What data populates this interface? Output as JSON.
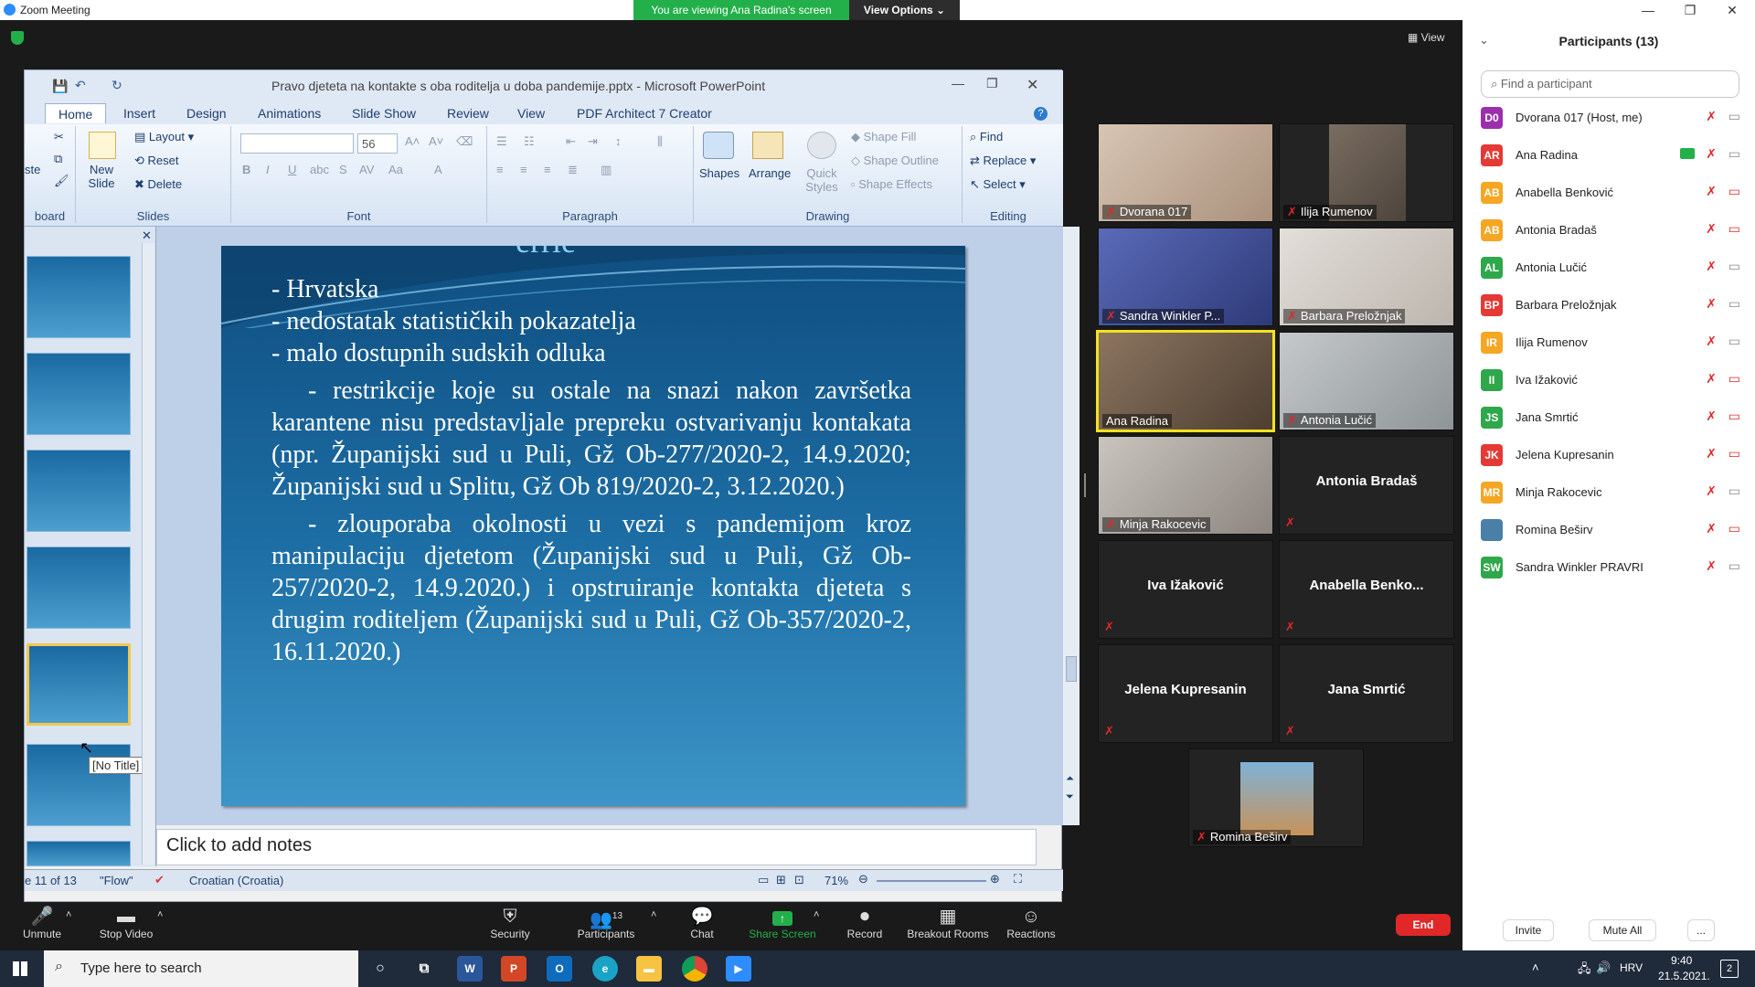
{
  "window": {
    "title": "Zoom Meeting",
    "banner": "You are viewing Ana Radina's screen",
    "view_options": "View Options",
    "view": "View"
  },
  "ppt": {
    "title": "Pravo djeteta na kontakte s oba roditelja u doba pandemije.pptx - Microsoft PowerPoint",
    "tabs": [
      "Home",
      "Insert",
      "Design",
      "Animations",
      "Slide Show",
      "Review",
      "View",
      "PDF Architect 7 Creator"
    ],
    "ribbon": {
      "clipboard_label": "board",
      "paste": "ste",
      "new_slide": "New Slide",
      "layout": "Layout",
      "reset": "Reset",
      "delete": "Delete",
      "slides_label": "Slides",
      "font_size": "56",
      "font_label": "Font",
      "paragraph_label": "Paragraph",
      "shapes": "Shapes",
      "arrange": "Arrange",
      "quick_styles": "Quick Styles",
      "shape_fill": "Shape Fill",
      "shape_outline": "Shape Outline",
      "shape_effects": "Shape Effects",
      "drawing_label": "Drawing",
      "find": "Find",
      "replace": "Replace",
      "select": "Select",
      "editing_label": "Editing"
    },
    "slide": {
      "title_fragment": "errie",
      "lines": [
        "- Hrvatska",
        "- nedostatak statističkih pokazatelja",
        "- malo dostupnih sudskih odluka"
      ],
      "para1": "- restrikcije koje su ostale na snazi nakon završetka karantene nisu predstavljale prepreku ostvarivanju kontakata (npr. Županijski sud u Puli, Gž Ob-277/2020-2, 14.9.2020; Županijski sud u Splitu, Gž Ob 819/2020-2, 3.12.2020.)",
      "para2": "- zlouporaba okolnosti u vezi s pandemijom kroz manipulaciju djetetom (Županijski sud u Puli, Gž Ob-257/2020-2, 14.9.2020.) i opstruiranje kontakta djeteta s drugim roditeljem (Županijski sud u Puli, Gž Ob-357/2020-2, 16.11.2020.)"
    },
    "tooltip": "[No Title]",
    "notes": "Click to add notes",
    "status": {
      "slide": "e 11 of 13",
      "theme": "\"Flow\"",
      "language": "Croatian (Croatia)",
      "zoom": "71%"
    }
  },
  "videos": [
    {
      "name": "Dvorana 017",
      "bg": "#c9b8a8",
      "kind": "video"
    },
    {
      "name": "Ilija Rumenov",
      "bg": "#6e6358",
      "kind": "video"
    },
    {
      "name": "Sandra Winkler P...",
      "bg": "#4a5aa8",
      "kind": "video"
    },
    {
      "name": "Barbara Preložnjak",
      "bg": "#d8d4cf",
      "kind": "video"
    },
    {
      "name": "Ana Radina",
      "bg": "#7d6a55",
      "kind": "video"
    },
    {
      "name": "Antonia Lučić",
      "bg": "#b8bcbe",
      "kind": "video"
    },
    {
      "name": "Minja Rakocevic",
      "bg": "#b5b0ab",
      "kind": "video"
    },
    {
      "name": "Antonia Bradaš",
      "kind": "name"
    },
    {
      "name": "Iva Ižaković",
      "kind": "name"
    },
    {
      "name": "Anabella Benko...",
      "kind": "name"
    },
    {
      "name": "Jelena Kupresanin",
      "kind": "name"
    },
    {
      "name": "Jana Smrtić",
      "kind": "name"
    },
    {
      "name": "Romina Beširv",
      "kind": "photo"
    }
  ],
  "participants": {
    "header": "Participants (13)",
    "search_placeholder": "Find a participant",
    "list": [
      {
        "initials": "D0",
        "name": "Dvorana 017 (Host, me)",
        "color": "#9b2fae",
        "cam_off": false
      },
      {
        "initials": "AR",
        "name": "Ana Radina",
        "color": "#e53935",
        "cam_off": false,
        "sharing": true
      },
      {
        "initials": "AB",
        "name": "Anabella Benković",
        "color": "#f5a623",
        "cam_off": true
      },
      {
        "initials": "AB",
        "name": "Antonia Bradaš",
        "color": "#f5a623",
        "cam_off": true
      },
      {
        "initials": "AL",
        "name": "Antonia Lučić",
        "color": "#2ea84a",
        "cam_off": false
      },
      {
        "initials": "BP",
        "name": "Barbara Preložnjak",
        "color": "#e53935",
        "cam_off": false
      },
      {
        "initials": "IR",
        "name": "Ilija Rumenov",
        "color": "#f5a623",
        "cam_off": false
      },
      {
        "initials": "II",
        "name": "Iva Ižaković",
        "color": "#2ea84a",
        "cam_off": true
      },
      {
        "initials": "JS",
        "name": "Jana Smrtić",
        "color": "#2ea84a",
        "cam_off": true
      },
      {
        "initials": "JK",
        "name": "Jelena Kupresanin",
        "color": "#e53935",
        "cam_off": true
      },
      {
        "initials": "MR",
        "name": "Minja Rakocevic",
        "color": "#f5a623",
        "cam_off": false
      },
      {
        "initials": "",
        "name": "Romina Beširv",
        "color": "#4a7fa8",
        "cam_off": true
      },
      {
        "initials": "SW",
        "name": "Sandra Winkler PRAVRI",
        "color": "#2ea84a",
        "cam_off": false
      }
    ],
    "invite": "Invite",
    "mute_all": "Mute All",
    "more": "..."
  },
  "toolbar": {
    "unmute": "Unmute",
    "stop_video": "Stop Video",
    "security": "Security",
    "participants": "Participants",
    "participants_count": "13",
    "chat": "Chat",
    "share_screen": "Share Screen",
    "record": "Record",
    "breakout": "Breakout Rooms",
    "reactions": "Reactions",
    "end": "End"
  },
  "taskbar": {
    "search_placeholder": "Type here to search",
    "language": "HRV",
    "time": "9:40",
    "date": "21.5.2021.",
    "notifications": "2"
  }
}
